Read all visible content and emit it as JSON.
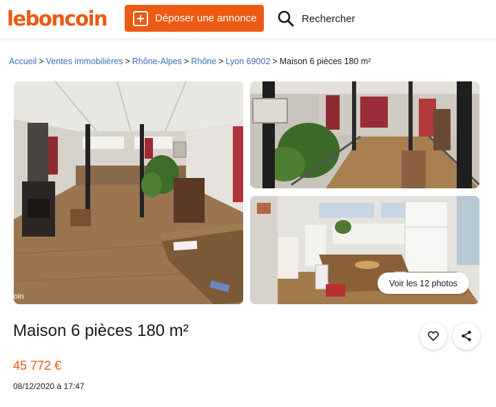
{
  "header": {
    "logo": "leboncoin",
    "post_button_label": "Déposer une annonce",
    "search_label": "Rechercher",
    "accent_color": "#ec5a13"
  },
  "breadcrumb": {
    "items": [
      "Accueil",
      "Ventes immobilières",
      "Rhône-Alpes",
      "Rhône",
      "Lyon 69002"
    ],
    "current": "Maison 6 pièces 180 m²",
    "separator": ">"
  },
  "gallery": {
    "see_photos_label": "Voir les 12 photos",
    "corner_text": "oin"
  },
  "listing": {
    "title": "Maison 6 pièces 180 m²",
    "price": "45 772 €",
    "date": "08/12/2020 à 17:47"
  },
  "icons": {
    "post": "plus-square-icon",
    "search": "magnifier-icon",
    "favorite": "heart-icon",
    "share": "share-icon"
  }
}
